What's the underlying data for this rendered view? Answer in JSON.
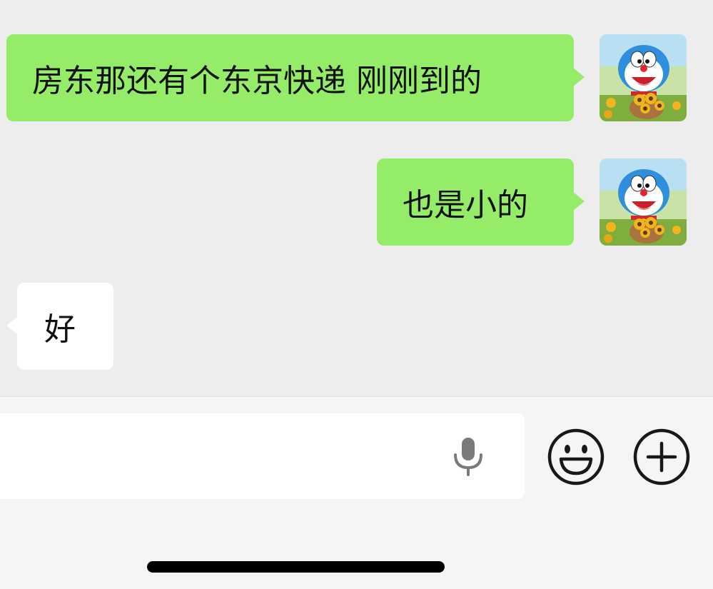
{
  "messages": [
    {
      "direction": "sent",
      "text": "房东那还有个东京快递 刚刚到的",
      "avatar": "doraemon-avatar"
    },
    {
      "direction": "sent",
      "text": "也是小的",
      "avatar": "doraemon-avatar"
    },
    {
      "direction": "received",
      "text": "好"
    }
  ],
  "input": {
    "value": "",
    "voice_icon": "microphone-icon",
    "emoji_icon": "smiley-icon",
    "more_icon": "plus-circle-icon"
  },
  "colors": {
    "chat_background": "#ededed",
    "sent_bubble": "#95ec69",
    "received_bubble": "#ffffff",
    "input_bar": "#f5f5f5"
  }
}
